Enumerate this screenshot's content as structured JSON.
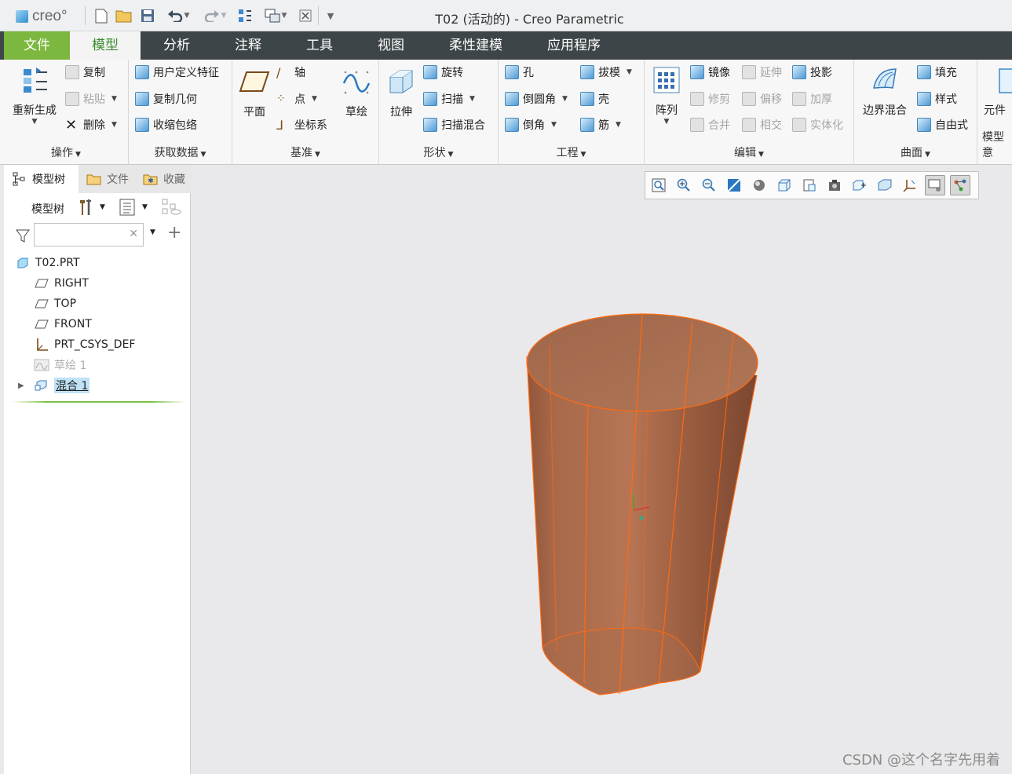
{
  "app": {
    "logo_text": "creo°",
    "window_title": "T02 (活动的) - Creo Parametric"
  },
  "menu": {
    "tabs": [
      "文件",
      "模型",
      "分析",
      "注释",
      "工具",
      "视图",
      "柔性建模",
      "应用程序"
    ]
  },
  "ribbon": {
    "ops": {
      "regenerate": "重新生成",
      "copy": "复制",
      "paste": "粘贴",
      "delete": "删除",
      "label": "操作"
    },
    "get_data": {
      "udf": "用户定义特征",
      "copy_geom": "复制几何",
      "shrinkwrap": "收缩包络",
      "label": "获取数据"
    },
    "datum": {
      "plane": "平面",
      "axis": "轴",
      "point": "点",
      "csys": "坐标系",
      "sketch": "草绘",
      "label": "基准"
    },
    "shapes": {
      "extrude": "拉伸",
      "revolve": "旋转",
      "sweep": "扫描",
      "swept_blend": "扫描混合",
      "label": "形状"
    },
    "engineering": {
      "hole": "孔",
      "round": "倒圆角",
      "chamfer": "倒角",
      "draft": "拔模",
      "shell": "壳",
      "rib": "筋",
      "label": "工程"
    },
    "editing": {
      "pattern": "阵列",
      "mirror": "镜像",
      "trim": "修剪",
      "merge": "合并",
      "extend": "延伸",
      "offset": "偏移",
      "intersect": "相交",
      "project": "投影",
      "thicken": "加厚",
      "solidify": "实体化",
      "label": "编辑"
    },
    "surfaces": {
      "boundary_blend": "边界混合",
      "fill": "填充",
      "style": "样式",
      "freestyle": "自由式",
      "label": "曲面"
    },
    "model_intent": {
      "component": "元件",
      "label": "模型意"
    }
  },
  "panel": {
    "tabs": [
      "模型树",
      "文件",
      "收藏"
    ],
    "tree_toolbar_label": "模型树",
    "search_placeholder": "",
    "tree": [
      {
        "label": "T02.PRT",
        "icon": "part-icon",
        "state": "normal"
      },
      {
        "label": "RIGHT",
        "icon": "datum-plane-icon",
        "state": "normal"
      },
      {
        "label": "TOP",
        "icon": "datum-plane-icon",
        "state": "normal"
      },
      {
        "label": "FRONT",
        "icon": "datum-plane-icon",
        "state": "normal"
      },
      {
        "label": "PRT_CSYS_DEF",
        "icon": "csys-icon",
        "state": "normal"
      },
      {
        "label": "草绘 1",
        "icon": "sketch-icon",
        "state": "disabled"
      },
      {
        "label": "混合 1",
        "icon": "blend-icon",
        "state": "selected"
      }
    ]
  },
  "viewport": {
    "model_color": "#b57250",
    "edge_color": "#ff6a10",
    "background": "#e9e9eb"
  },
  "watermark": "CSDN @这个名字先用着"
}
